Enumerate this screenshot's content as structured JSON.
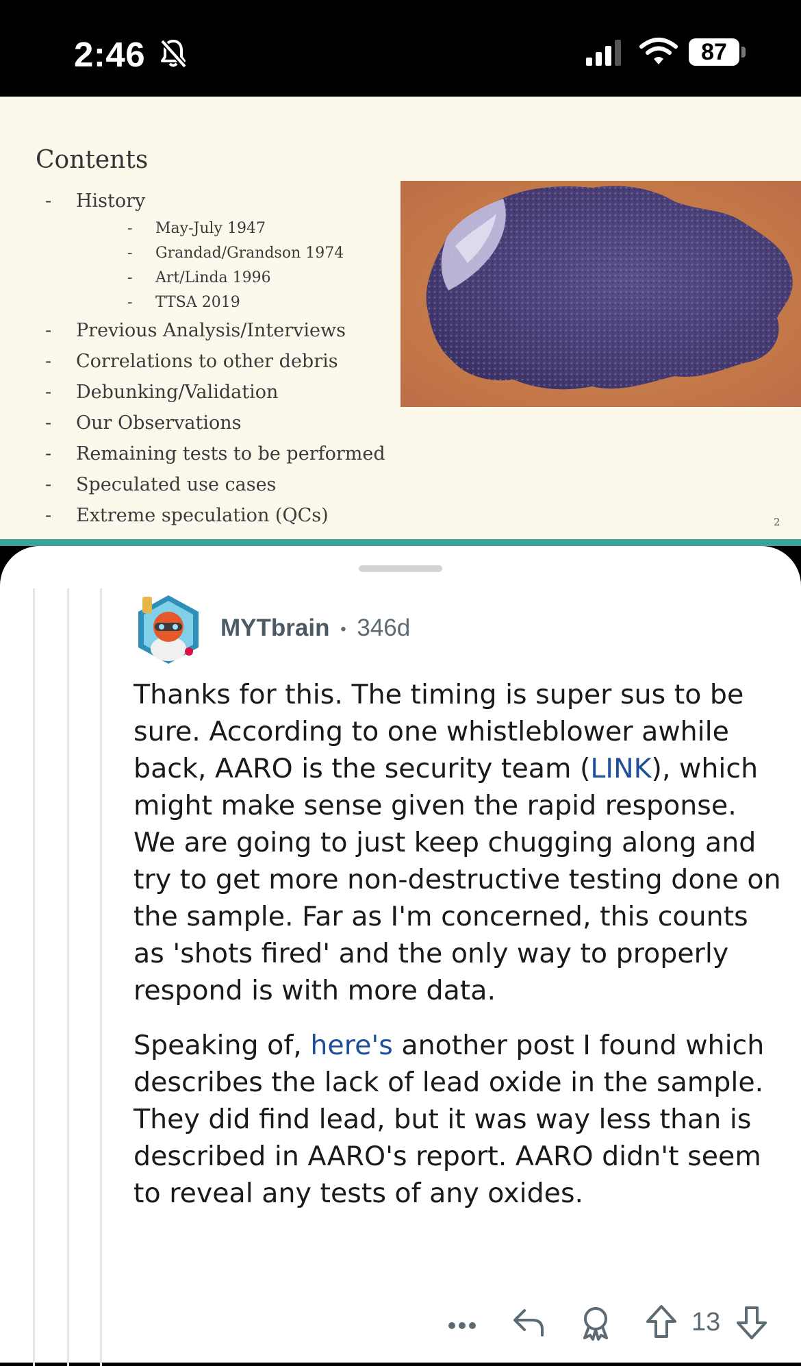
{
  "status_bar": {
    "time": "2:46",
    "battery": "87"
  },
  "slide": {
    "title": "Contents",
    "items": [
      {
        "level": 1,
        "text": "History"
      },
      {
        "level": 2,
        "text": "May-July 1947"
      },
      {
        "level": 2,
        "text": "Grandad/Grandson 1974"
      },
      {
        "level": 2,
        "text": "Art/Linda 1996"
      },
      {
        "level": 2,
        "text": "TTSA 2019"
      },
      {
        "level": 1,
        "text": "Previous Analysis/Interviews"
      },
      {
        "level": 1,
        "text": "Correlations to other debris"
      },
      {
        "level": 1,
        "text": "Debunking/Validation"
      },
      {
        "level": 1,
        "text": "Our Observations"
      },
      {
        "level": 1,
        "text": "Remaining tests to be performed"
      },
      {
        "level": 1,
        "text": "Speculated use cases"
      },
      {
        "level": 1,
        "text": "Extreme speculation (QCs)"
      }
    ],
    "page_number": "2"
  },
  "comment": {
    "username": "MYTbrain",
    "separator": "•",
    "age": "346d",
    "p1_before_link": "Thanks for this. The timing is super sus to be sure. According to one whistleblower awhile back, AARO is the security team (",
    "p1_link": "LINK",
    "p1_after_link": "), which might make sense given the rapid response. We are going to just keep chugging along and try to get more non-destructive testing done on the sample. Far as I'm concerned, this counts as 'shots fired' and the only way to properly respond is with more data.",
    "p2_link": "here's",
    "p2_before_link": "Speaking of, ",
    "p2_after_link": " another post I found which describes the lack of lead oxide in the sample. They did find lead, but it was way less than is described in AARO's report. AARO didn't seem to reveal any tests of any oxides.",
    "vote_count": "13"
  },
  "colors": {
    "link": "#1d4f9a",
    "meta": "#5c6a73",
    "slide_bg": "#fcf9ec",
    "accent_line": "#3aa39b"
  },
  "icons": [
    "bell-slash-icon",
    "signal-icon",
    "wifi-icon",
    "more-icon",
    "reply-icon",
    "award-icon",
    "upvote-icon",
    "downvote-icon"
  ]
}
